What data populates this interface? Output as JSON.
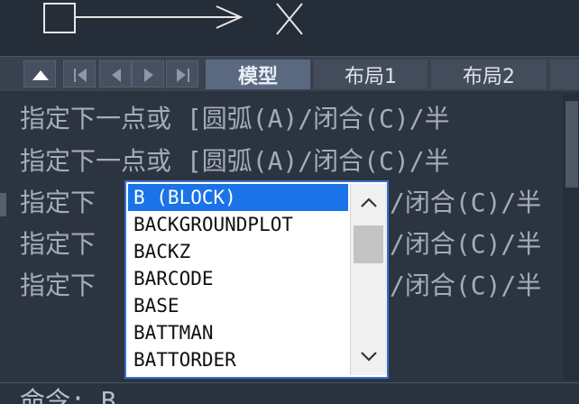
{
  "tabs": {
    "model_label": "模型",
    "layout1_label": "布局1",
    "layout2_label": "布局2"
  },
  "history": {
    "lines": [
      "指定下一点或 [圆弧(A)/闭合(C)/半",
      "指定下一点或 [圆弧(A)/闭合(C)/半",
      "指定下",
      "指定下",
      "指定下"
    ],
    "tail": "/闭合(C)/半"
  },
  "autocomplete": {
    "items": [
      "B (BLOCK)",
      "BACKGROUNDPLOT",
      "BACKZ",
      "BARCODE",
      "BASE",
      "BATTMAN",
      "BATTORDER"
    ],
    "selected_index": 0
  },
  "command": {
    "prompt": "命令: B"
  },
  "icons": {
    "scroll_up": "chevron-up-icon",
    "scroll_down": "chevron-down-icon"
  },
  "colors": {
    "accent": "#1a73e8",
    "background": "#2b3340"
  }
}
